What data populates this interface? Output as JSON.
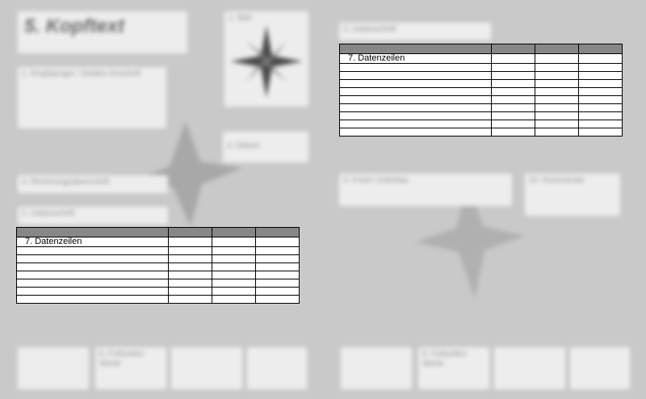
{
  "sections": {
    "kopftext": "5. Kopftext",
    "logo": "1. Bild",
    "anschrift": "1. Empfaenger / Debitor Anschrift",
    "datum": "3. Datum",
    "rechnung": "4. Rechnungsüberschrift",
    "ueberschrift_left": "2. Ueberschrift",
    "ueberschrift_right": "2. Ueberschrift",
    "freier_unterbau": "3. Freier Unterbau",
    "kommentar": "10. Kommentar",
    "fusszeile_left": "6. Fußzeilen Werte",
    "fusszeile_right": "6. Fußzeilen Werte"
  },
  "table_left": {
    "label": "7. Datenzeilen",
    "columns": 4,
    "data_rows": 8
  },
  "table_right": {
    "label": "7. Datenzeilen",
    "columns": 4,
    "data_rows": 10
  }
}
